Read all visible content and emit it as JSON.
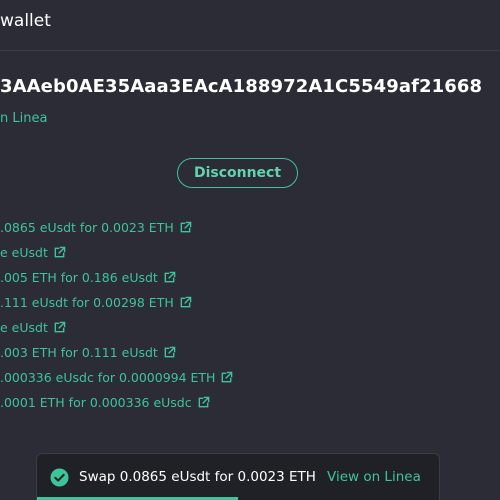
{
  "header": {
    "title": "wallet"
  },
  "account": {
    "address": "3AAeb0AE35Aaa3EAcA188972A1C5549af21668",
    "network": "n Linea"
  },
  "disconnect_label": "Disconnect",
  "transactions": [
    {
      "text": ".0865 eUsdt for 0.0023 ETH",
      "icon": "external-link-icon"
    },
    {
      "text": "e eUsdt",
      "icon": "external-link-icon"
    },
    {
      "text": ".005 ETH for 0.186 eUsdt",
      "icon": "external-link-icon"
    },
    {
      "text": ".111 eUsdt for 0.00298 ETH",
      "icon": "external-link-icon"
    },
    {
      "text": "e eUsdt",
      "icon": "external-link-icon"
    },
    {
      "text": ".003 ETH for 0.111 eUsdt",
      "icon": "external-link-icon"
    },
    {
      "text": ".000336 eUsdc for 0.0000994 ETH",
      "icon": "external-link-icon"
    },
    {
      "text": ".0001 ETH for 0.000336 eUsdc",
      "icon": "external-link-icon"
    }
  ],
  "toast": {
    "message": "Swap 0.0865 eUsdt for 0.0023 ETH",
    "link_label": "View on Linea",
    "icon": "check-circle-icon",
    "progress": 0.5
  },
  "colors": {
    "background": "#2b2c35",
    "accent": "#3fc39a",
    "toast_background": "#202127"
  }
}
